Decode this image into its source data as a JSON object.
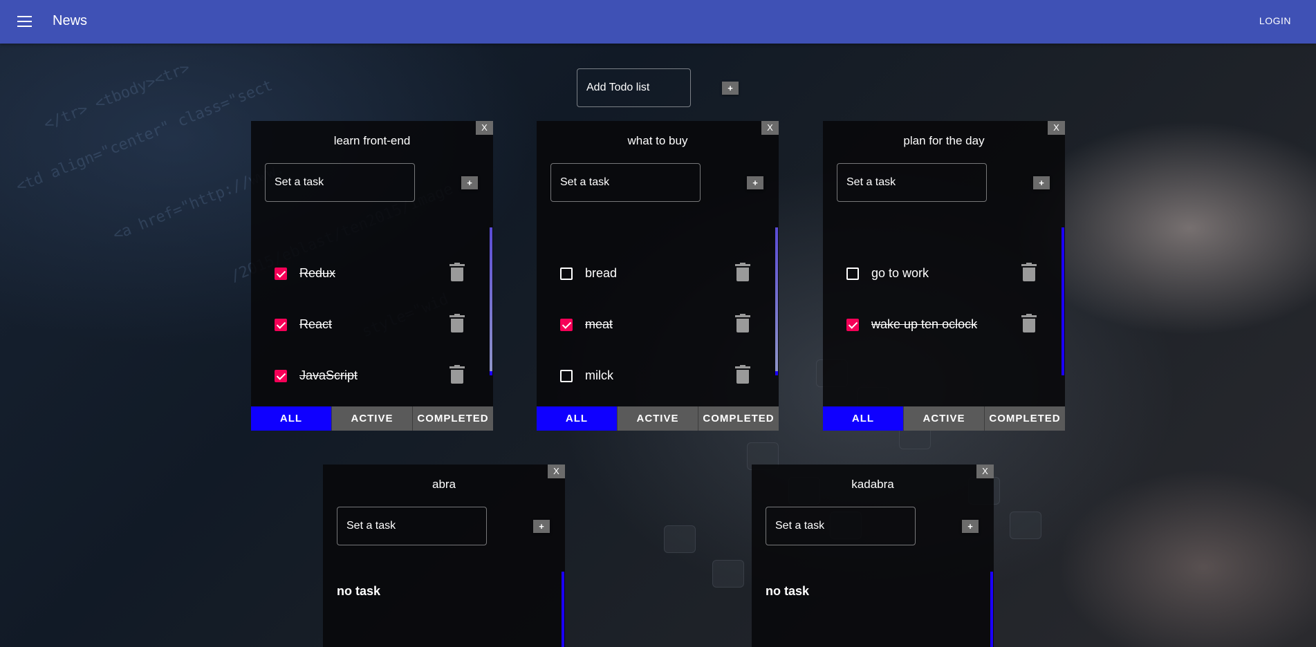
{
  "appbar": {
    "title": "News",
    "login_label": "LOGIN",
    "menu_icon": "menu-icon",
    "color": "#3f51b5"
  },
  "add_list": {
    "placeholder": "Add Todo list",
    "add_label": "+"
  },
  "filter_labels": [
    "ALL",
    "ACTIVE",
    "COMPLETED"
  ],
  "accent_colors": {
    "filter_active": "#0f00ff",
    "checkbox_checked": "#f50057"
  },
  "lists": [
    {
      "title": "learn front-end",
      "close_label": "X",
      "task_placeholder": "Set a task",
      "add_label": "+",
      "active_filter": "ALL",
      "tasks": [
        {
          "label": "Redux",
          "done": true
        },
        {
          "label": "React",
          "done": true
        },
        {
          "label": "JavaScript",
          "done": true
        }
      ]
    },
    {
      "title": "what to buy",
      "close_label": "X",
      "task_placeholder": "Set a task",
      "add_label": "+",
      "active_filter": "ALL",
      "tasks": [
        {
          "label": "bread",
          "done": false
        },
        {
          "label": "meat",
          "done": true
        },
        {
          "label": "milck",
          "done": false
        }
      ]
    },
    {
      "title": "plan for the day",
      "close_label": "X",
      "task_placeholder": "Set a task",
      "add_label": "+",
      "active_filter": "ALL",
      "tasks": [
        {
          "label": "go to work",
          "done": false
        },
        {
          "label": "wake up ten oclock",
          "done": true
        }
      ]
    },
    {
      "title": "abra",
      "close_label": "X",
      "task_placeholder": "Set a task",
      "add_label": "+",
      "empty_text": "no task",
      "tasks": []
    },
    {
      "title": "kadabra",
      "close_label": "X",
      "task_placeholder": "Set a task",
      "add_label": "+",
      "empty_text": "no task",
      "tasks": []
    }
  ]
}
